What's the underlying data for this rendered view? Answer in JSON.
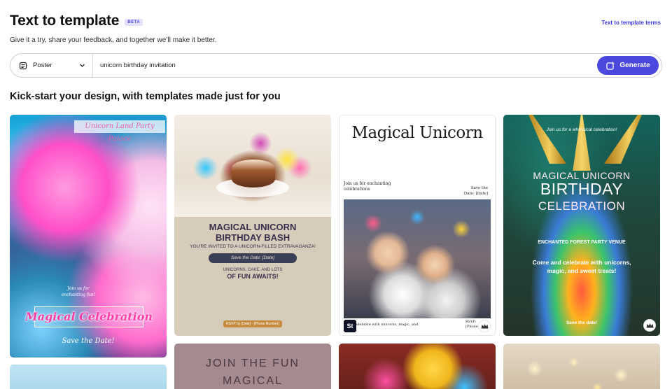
{
  "header": {
    "title": "Text to template",
    "badge": "BETA",
    "terms_link": "Text to template terms",
    "subtitle": "Give it a try, share your feedback, and together we’ll make it better."
  },
  "prompt_bar": {
    "format_icon": "poster-icon",
    "format_value": "Poster",
    "dropdown_icon": "chevron-down-icon",
    "input_value": "unicorn birthday invitation",
    "generate_label": "Generate",
    "generate_icon": "sparkle-generate-icon"
  },
  "section": {
    "heading": "Kick-start your design, with templates made just for you"
  },
  "colors": {
    "accent": "#4b48e0",
    "badge_bg": "#e3e1ff"
  },
  "templates": [
    {
      "top_label": "Unicorn Land Party Palace",
      "small_text": "Join us for enchanting fun!",
      "main_text": "Magical Celebration",
      "date_text": "Save the Date!"
    },
    {
      "title_lines": [
        "MAGICAL UNICORN",
        "BIRTHDAY BASH"
      ],
      "subtitle": "YOU'RE INVITED TO A UNICORN-FILLED EXTRAVAGANZA!",
      "pill": "Save the Date: [Date]",
      "small": "UNICORNS, CAKE, AND LOTS",
      "big": "OF FUN AWAITS!",
      "rsvp": "RSVP by [Date] - [Phone Number]"
    },
    {
      "title": "Magical Unicorn",
      "left_text": "Join us for enchanting celebrations",
      "right_text": "Save the Date: [Date]",
      "bottom_text": "Celebrate with unicorns, magic, and",
      "rsvp_text": "RSVP: [Phone]",
      "stock_badge": "St",
      "premium_icon": "crown-icon"
    },
    {
      "top_text": "Join us for a whimsical celebration!",
      "h1": "MAGICAL UNICORN",
      "h2": "BIRTHDAY",
      "h3": "CELEBRATION",
      "venue": "ENCHANTED FOREST PARTY VENUE",
      "body": "Come and celebrate with unicorns, magic, and sweet treats!",
      "date": "Save the date!",
      "premium_icon": "crown-icon"
    },
    {},
    {
      "line1": "JOIN THE FUN",
      "line2": "MAGICAL"
    },
    {},
    {}
  ]
}
